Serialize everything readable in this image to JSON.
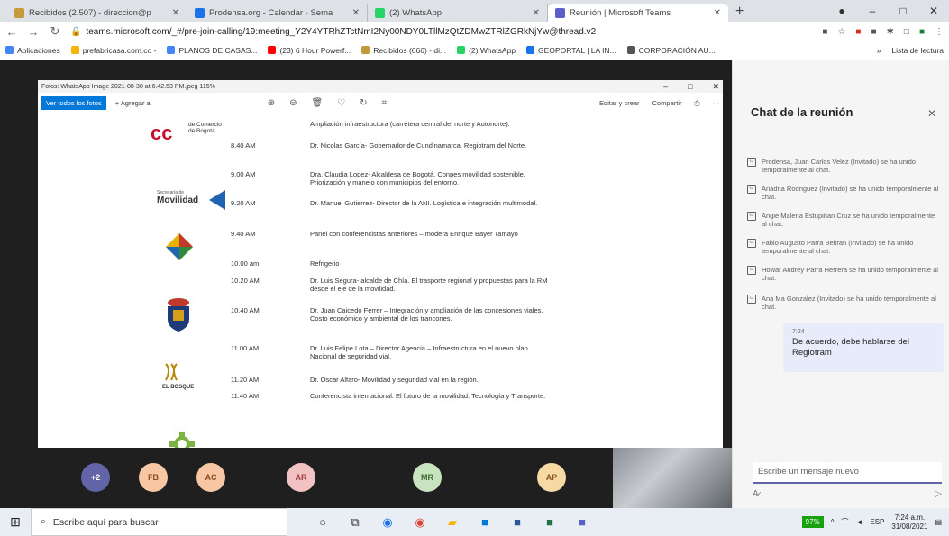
{
  "browser": {
    "tabs": [
      {
        "title": "Recibidos (2.507) - direccion@p",
        "icon": "mail-icon",
        "color": "#c49a3c",
        "active": false
      },
      {
        "title": "Prodensa.org - Calendar - Sema",
        "icon": "calendar-icon",
        "color": "#1a73e8",
        "active": false
      },
      {
        "title": "(2) WhatsApp",
        "icon": "whatsapp-icon",
        "color": "#25d366",
        "active": false
      },
      {
        "title": "Reunión | Microsoft Teams",
        "icon": "teams-icon",
        "color": "#5b5fc7",
        "active": true
      }
    ],
    "new_tab": "+",
    "window_controls": [
      "–",
      "□",
      "✕"
    ],
    "url": "teams.microsoft.com/_#/pre-join-calling/19:meeting_Y2Y4YTRhZTctNmI2Ny00NDY0LTllMzQtZDMwZTRlZGRkNjYw@thread.v2",
    "bookmarks": [
      {
        "label": "Aplicaciones",
        "color": "#4285f4"
      },
      {
        "label": "prefabricasa.com.co -",
        "color": "#f4b400"
      },
      {
        "label": "PLANOS DE CASAS...",
        "color": "#4285f4"
      },
      {
        "label": "(23) 6 Hour Powerf...",
        "color": "#ff0000"
      },
      {
        "label": "Recibidos (666) - di...",
        "color": "#c49a3c"
      },
      {
        "label": "(2) WhatsApp",
        "color": "#25d366"
      },
      {
        "label": "GEOPORTAL | LA IN...",
        "color": "#1a73e8"
      },
      {
        "label": "CORPORACIÓN AU...",
        "color": "#555555"
      }
    ],
    "reading_list": "Lista de lectura"
  },
  "viewer": {
    "title": "Fotos: WhatsApp Image 2021-08-30 at 6.42.53 PM.jpeg 115%",
    "see_all": "Ver todos los fotos",
    "add": "Agregar a",
    "edit": "Editar y crear",
    "share": "Compartir",
    "window_controls": [
      "–",
      "□",
      "✕"
    ]
  },
  "agenda": [
    {
      "time": "",
      "desc": "Ampliación infraestructura (carretera central del norte y Autonorte)."
    },
    {
      "time": "8.40 AM",
      "desc": "Dr. Nicolas García- Gobernador de Cundinamarca. Regiotram del Norte."
    },
    {
      "time": "9.00 AM",
      "desc": "Dra. Claudia Lopez- Alcaldesa de Bogotá. Conpes movilidad sostenible. Priorización y manejo con municipios del entorno."
    },
    {
      "time": "9.20 AM",
      "desc": "Dr. Manuel Gutierrez- Director de la ANI. Logística e integración multimodal."
    },
    {
      "time": "9.40 AM",
      "desc": "Panel con conferencistas anteriores – modera Enrique Bayer Tamayo"
    },
    {
      "time": "10.00 am",
      "desc": "Refrigerio"
    },
    {
      "time": "10.20 AM",
      "desc": "Dr. Luis Segura- alcalde de Chía. El trasporte regional y propuestas para la RM desde el eje de la movilidad."
    },
    {
      "time": "10.40 AM",
      "desc": "Dr. Juan Caicedo Ferrer – Integración y ampliación de las concesiones viales. Costo económico y ambiental de los trancones."
    },
    {
      "time": "11.00 AM",
      "desc": "Dr. Luis Felipe Lota – Director Agencia – Infraestructura en el nuevo plan Nacional de seguridad vial."
    },
    {
      "time": "11.20 AM",
      "desc": "Dr. Oscar Alfaro- Movilidad y seguridad vial en la región."
    },
    {
      "time": "11.40 AM",
      "desc": "Conferencista internacional. El futuro de la movilidad. Tecnología y Transporte."
    }
  ],
  "logos": {
    "camara": "de Comercio de Bogotá",
    "movilidad_small": "Secretaría de",
    "movilidad": "Movilidad",
    "bosque": "EL BOSQUE"
  },
  "participants": [
    {
      "initials": "+2",
      "bg": "#6264a7",
      "fg": "#ffffff"
    },
    {
      "initials": "FB",
      "bg": "#f7c7a3",
      "fg": "#8a4a1e"
    },
    {
      "initials": "AC",
      "bg": "#f7c7a3",
      "fg": "#8a4a1e"
    },
    {
      "initials": "AR",
      "bg": "#f2c2c2",
      "fg": "#a13b3b"
    },
    {
      "initials": "MR",
      "bg": "#c7e3c0",
      "fg": "#3b6b2e"
    },
    {
      "initials": "AP",
      "bg": "#f7d9a3",
      "fg": "#8a5a1e"
    }
  ],
  "chat": {
    "title": "Chat de la reunión",
    "system_messages": [
      "Prodensa, Juan Carlos Velez (Invitado) se ha unido temporalmente al chat.",
      "Ariadna Rodriguez (Invitado) se ha unido temporalmente al chat.",
      "Angie Malena Estupiñan Cruz se ha unido temporalmente al chat.",
      "Fabio Augusto Parra Beltran (Invitado) se ha unido temporalmente al chat.",
      "Howar Andrey Parra Herrera se ha unido temporalmente al chat.",
      "Ana Ma Gonzalez (Invitado) se ha unido temporalmente al chat."
    ],
    "message": {
      "time": "7:24",
      "text": "De acuerdo, debe hablarse del Regiotram"
    },
    "compose_placeholder": "Escribe un mensaje nuevo"
  },
  "taskbar": {
    "search": "Escribe aquí para buscar",
    "battery": "97%",
    "lang": "ESP",
    "time": "7:24 a.m.",
    "date": "31/08/2021"
  }
}
